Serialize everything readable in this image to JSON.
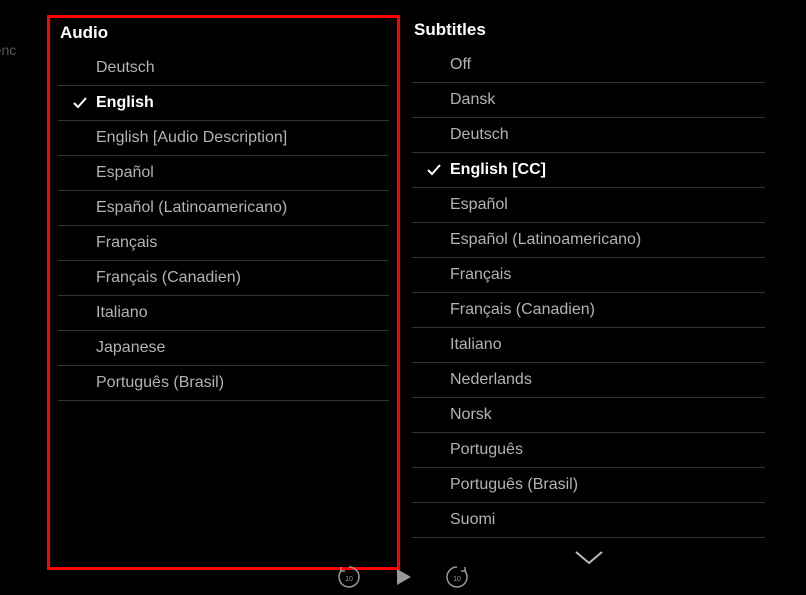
{
  "background": {
    "text": "udienc"
  },
  "audio": {
    "title": "Audio",
    "items": [
      {
        "label": "Deutsch",
        "selected": false
      },
      {
        "label": "English",
        "selected": true
      },
      {
        "label": "English [Audio Description]",
        "selected": false
      },
      {
        "label": "Español",
        "selected": false
      },
      {
        "label": "Español (Latinoamericano)",
        "selected": false
      },
      {
        "label": "Français",
        "selected": false
      },
      {
        "label": "Français (Canadien)",
        "selected": false
      },
      {
        "label": "Italiano",
        "selected": false
      },
      {
        "label": "Japanese",
        "selected": false
      },
      {
        "label": "Português (Brasil)",
        "selected": false
      }
    ]
  },
  "subtitles": {
    "title": "Subtitles",
    "items": [
      {
        "label": "Off",
        "selected": false
      },
      {
        "label": "Dansk",
        "selected": false
      },
      {
        "label": "Deutsch",
        "selected": false
      },
      {
        "label": "English [CC]",
        "selected": true
      },
      {
        "label": "Español",
        "selected": false
      },
      {
        "label": "Español (Latinoamericano)",
        "selected": false
      },
      {
        "label": "Français",
        "selected": false
      },
      {
        "label": "Français (Canadien)",
        "selected": false
      },
      {
        "label": "Italiano",
        "selected": false
      },
      {
        "label": "Nederlands",
        "selected": false
      },
      {
        "label": "Norsk",
        "selected": false
      },
      {
        "label": "Português",
        "selected": false
      },
      {
        "label": "Português (Brasil)",
        "selected": false
      },
      {
        "label": "Suomi",
        "selected": false
      }
    ]
  }
}
